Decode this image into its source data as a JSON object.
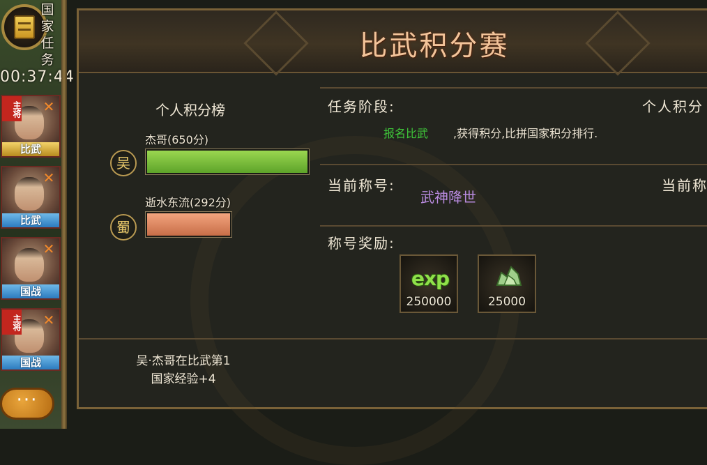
{
  "sidebar": {
    "quest_label": "国家任务",
    "timer": "00:37:44",
    "heroes": [
      {
        "badge": "主将",
        "caption": "比武",
        "caption_color": "#b88b1e"
      },
      {
        "badge": "",
        "caption": "比武",
        "caption_color": "#2c7bbf"
      },
      {
        "badge": "",
        "caption": "国战",
        "caption_color": "#2c7bbf"
      },
      {
        "badge": "主将",
        "caption": "国战",
        "caption_color": "#2c7bbf"
      }
    ],
    "chat_label": "···"
  },
  "panel": {
    "title": "比武积分赛",
    "leaderboard": {
      "title": "个人积分榜",
      "entries": [
        {
          "faction": "吴",
          "name": "杰哥(650分)",
          "score": 650,
          "bar_color": "#7cc23c"
        },
        {
          "faction": "蜀",
          "name": "逝水东流(292分)",
          "score": 292,
          "bar_color": "#e08a62"
        }
      ],
      "note_line1": "吴·杰哥在比武第1",
      "note_line2": "国家经验+4"
    },
    "task_stage": {
      "label": "任务阶段:",
      "right_label": "个人积分",
      "link_text": "报名比武",
      "description": ",获得积分,比拼国家积分排行."
    },
    "current_title": {
      "label": "当前称号:",
      "value": "武神降世",
      "right_label": "当前称"
    },
    "title_reward": {
      "label": "称号奖励:",
      "items": [
        {
          "icon": "exp-icon",
          "glyph": "exp",
          "amount": "250000"
        },
        {
          "icon": "ore-icon",
          "amount": "25000"
        }
      ]
    }
  },
  "colors": {
    "accent_gold": "#7a6238",
    "title_text": "#f3c49a",
    "green_link": "#3fc83a",
    "purple_title": "#b98be0"
  }
}
